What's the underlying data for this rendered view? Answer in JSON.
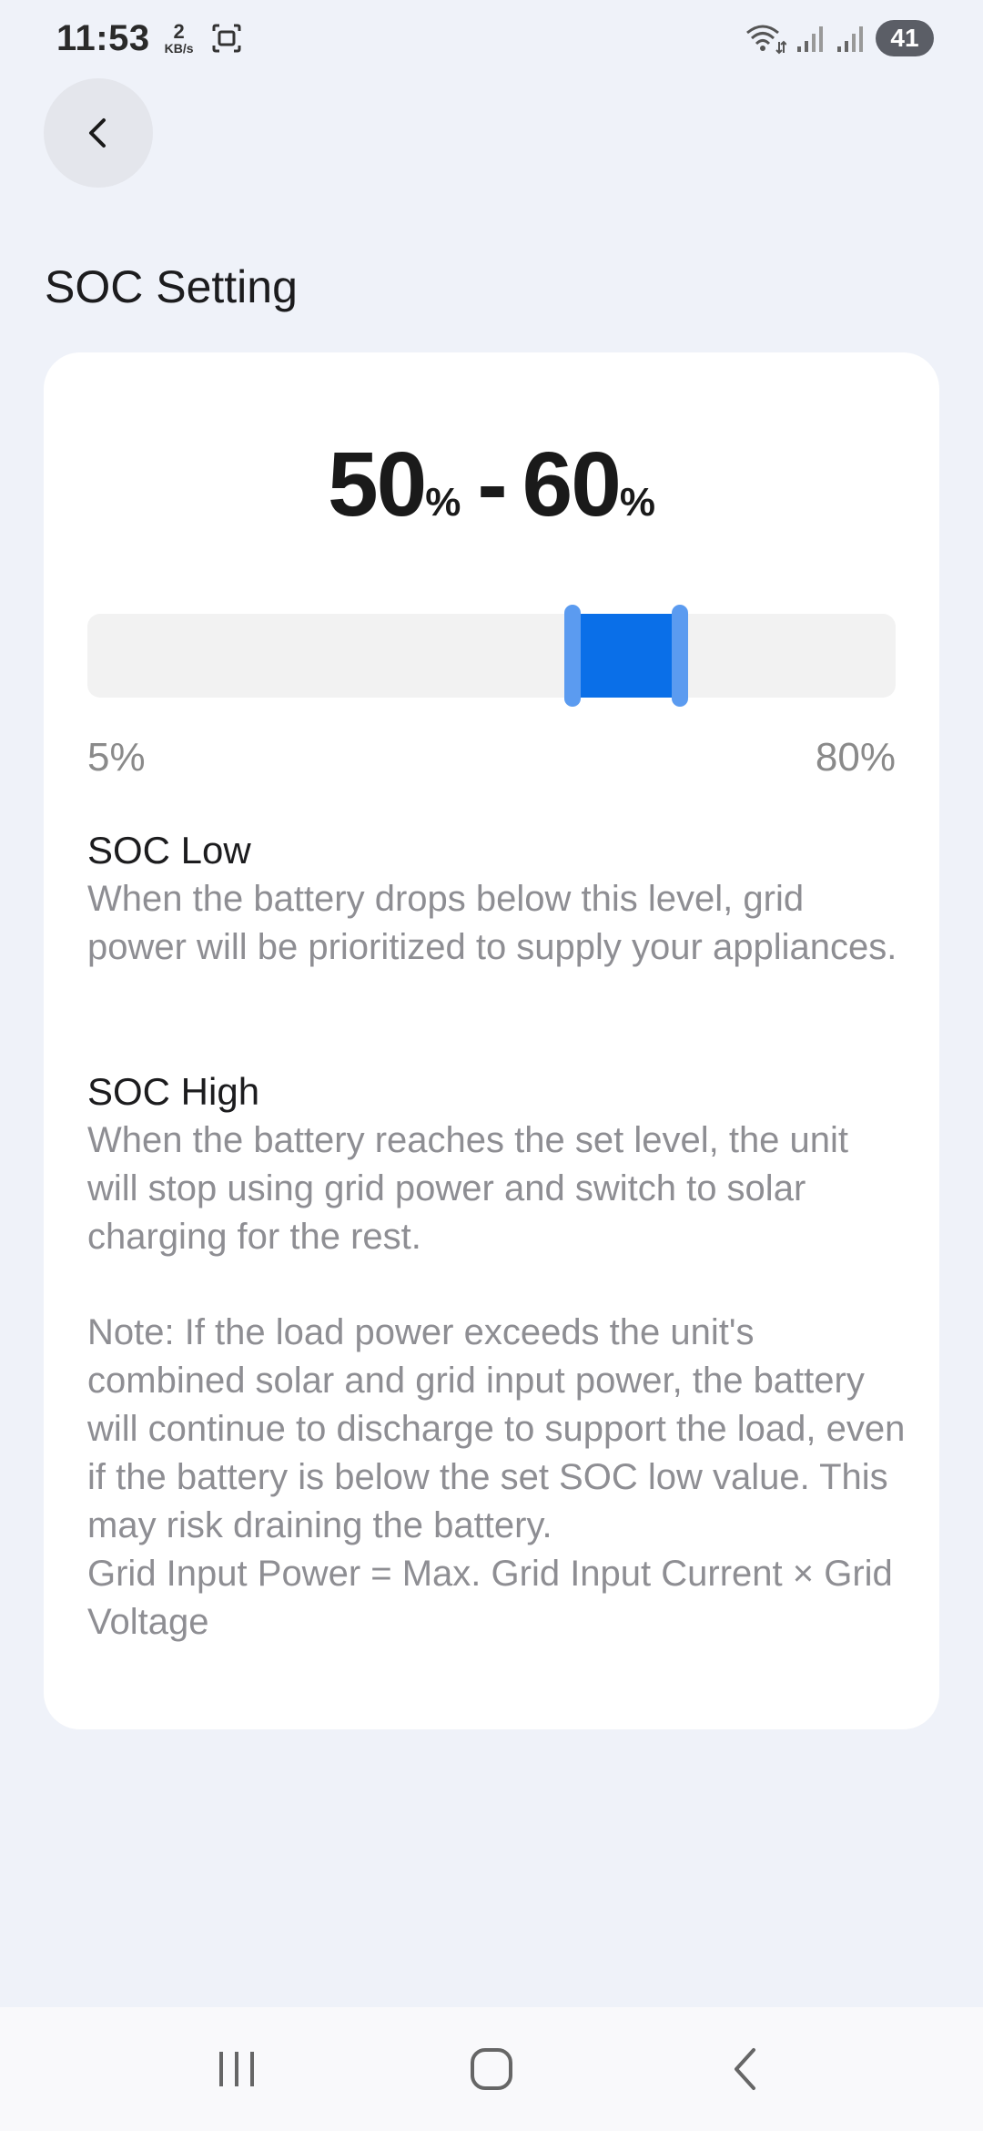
{
  "status_bar": {
    "time": "11:53",
    "net_speed_value": "2",
    "net_speed_unit": "KB/s",
    "battery_level": "41"
  },
  "header": {
    "title": "SOC Setting"
  },
  "range": {
    "low_value": "50",
    "high_value": "60",
    "percent_sign": "%",
    "separator": "-"
  },
  "slider": {
    "min_label": "5%",
    "max_label": "80%",
    "min": 5,
    "max": 80,
    "low": 50,
    "high": 60,
    "accent_color": "#0a6fe8",
    "handle_color": "#5b9bf0"
  },
  "soc_low": {
    "title": "SOC Low",
    "description": "When the battery drops below this level, grid power will be prioritized to supply your appliances."
  },
  "soc_high": {
    "title": "SOC High",
    "description": "When the battery reaches the set level, the unit will stop using grid power and switch to solar charging for the rest."
  },
  "note": {
    "text": "Note: If the load power exceeds the unit's combined solar and grid input power, the battery will continue to discharge to support the load, even if the battery is below the set SOC low value. This may risk draining the battery.\n Grid Input Power = Max. Grid Input Current × Grid Voltage"
  },
  "icons": {
    "back": "chevron-left-icon",
    "nav_recents": "recents-icon",
    "nav_home": "home-icon",
    "nav_back": "back-icon"
  }
}
